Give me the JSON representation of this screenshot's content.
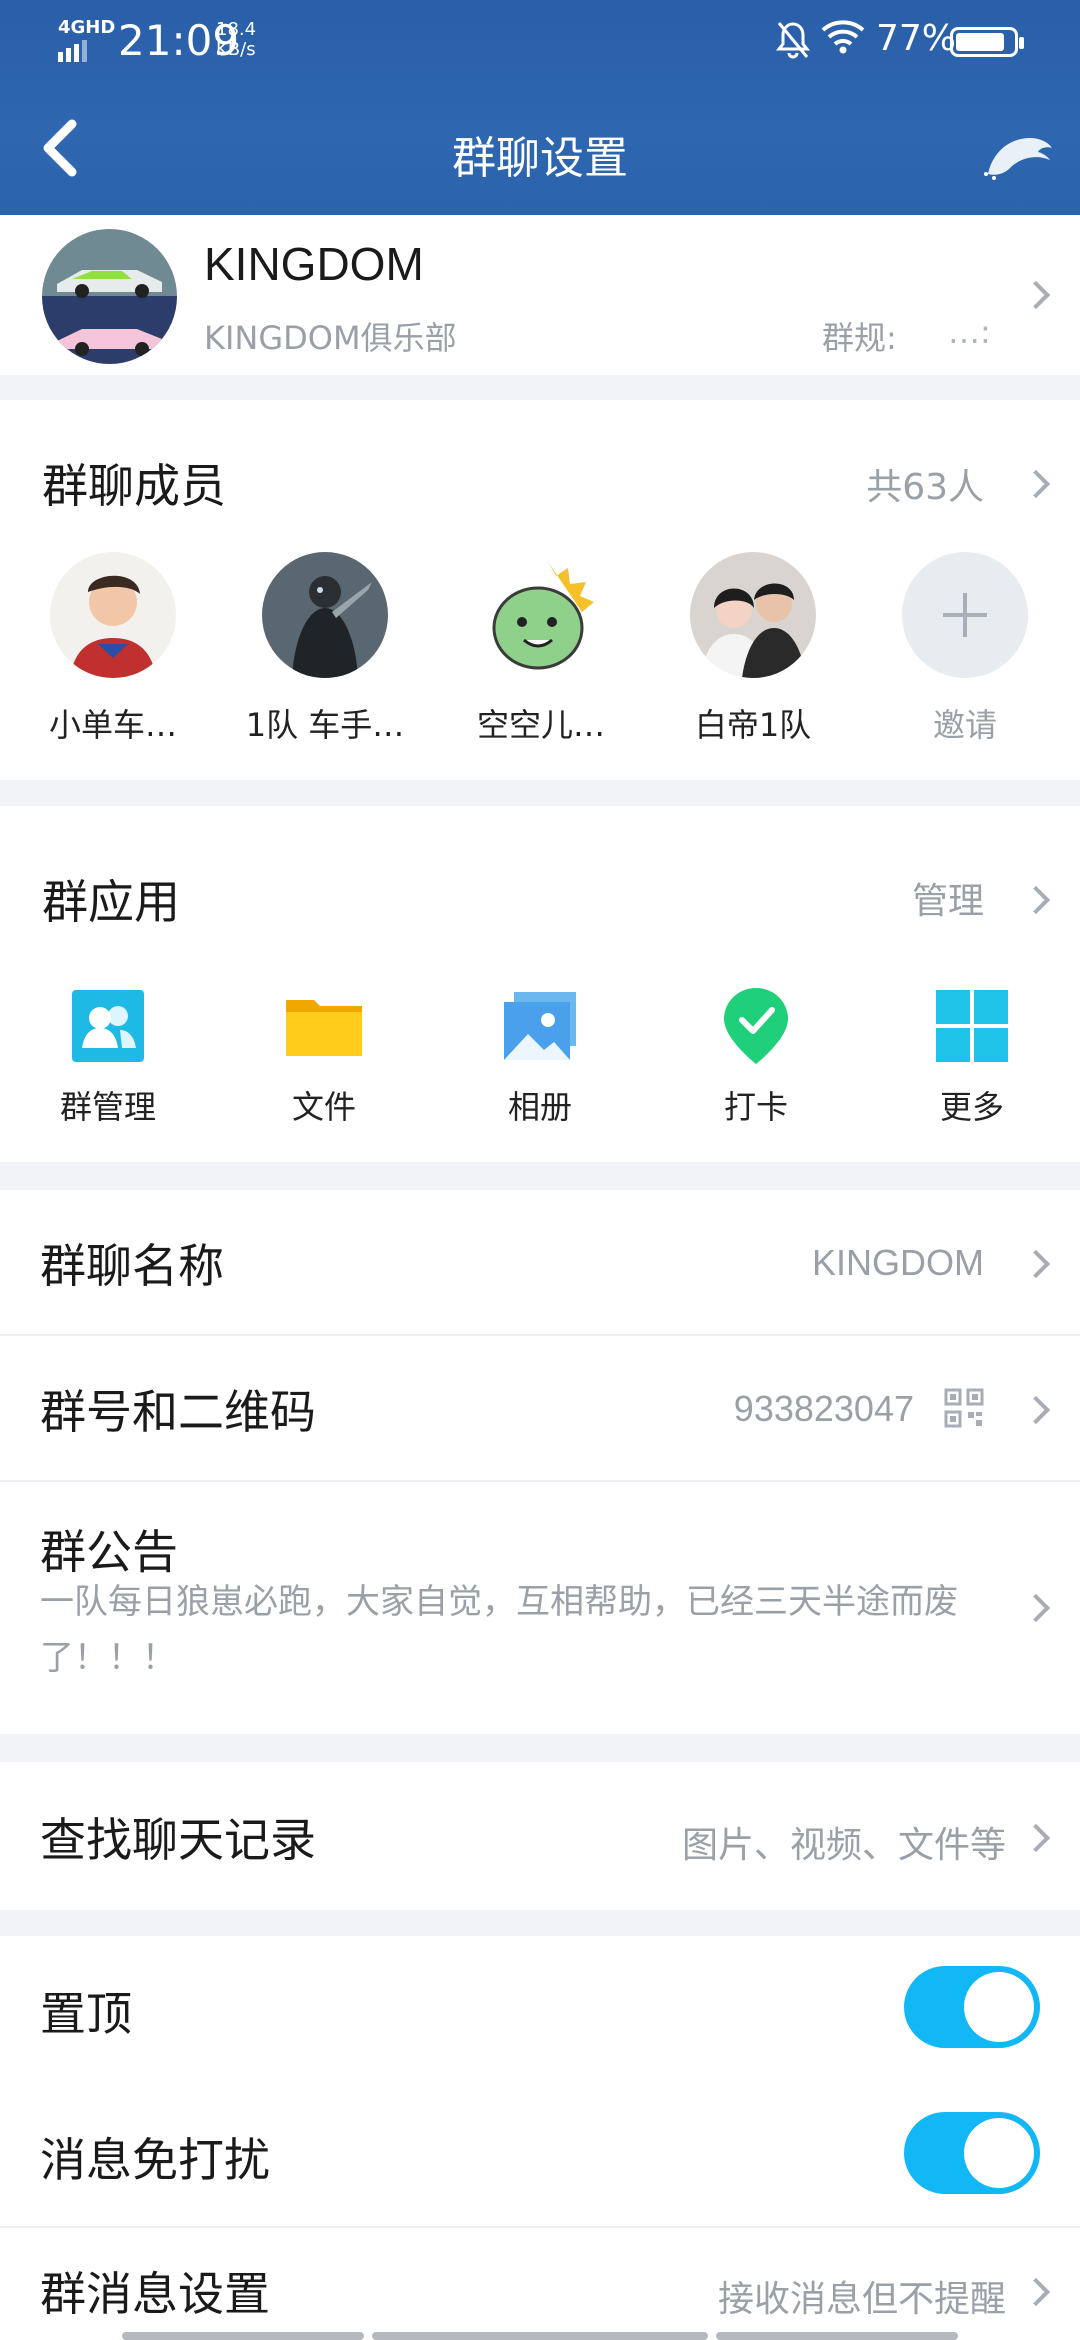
{
  "status_bar": {
    "network": "4GHD",
    "time": "21:09",
    "speed_value": "18.4",
    "speed_unit": "KB/s",
    "battery": "77%"
  },
  "header": {
    "title": "群聊设置"
  },
  "group": {
    "name": "KINGDOM",
    "subtitle": "KINGDOM俱乐部",
    "rule_label": "群规:",
    "rule_value": "…:"
  },
  "members": {
    "title": "群聊成员",
    "count": "共63人",
    "items": [
      {
        "name": "小单车…"
      },
      {
        "name": "1队 车手…"
      },
      {
        "name": "空空儿…"
      },
      {
        "name": "白帝1队"
      }
    ],
    "invite_label": "邀请"
  },
  "apps": {
    "title": "群应用",
    "manage": "管理",
    "items": [
      {
        "label": "群管理",
        "icon": "group-manage-icon"
      },
      {
        "label": "文件",
        "icon": "folder-icon"
      },
      {
        "label": "相册",
        "icon": "album-icon"
      },
      {
        "label": "打卡",
        "icon": "checkin-icon"
      },
      {
        "label": "更多",
        "icon": "more-grid-icon"
      }
    ]
  },
  "settings": {
    "name_label": "群聊名称",
    "name_value": "KINGDOM",
    "number_label": "群号和二维码",
    "number_value": "933823047",
    "notice_label": "群公告",
    "notice_text": "一队每日狼崽必跑，大家自觉，互相帮助，已经三天半途而废了！！！",
    "search_label": "查找聊天记录",
    "search_hint": "图片、视频、文件等",
    "pin_label": "置顶",
    "pin_on": true,
    "dnd_label": "消息免打扰",
    "dnd_on": true,
    "msg_label": "群消息设置",
    "msg_value": "接收消息但不提醒"
  },
  "colors": {
    "header_blue": "#2e66b0",
    "toggle_on": "#12b7f5",
    "secondary_text": "#9aa0a8"
  }
}
